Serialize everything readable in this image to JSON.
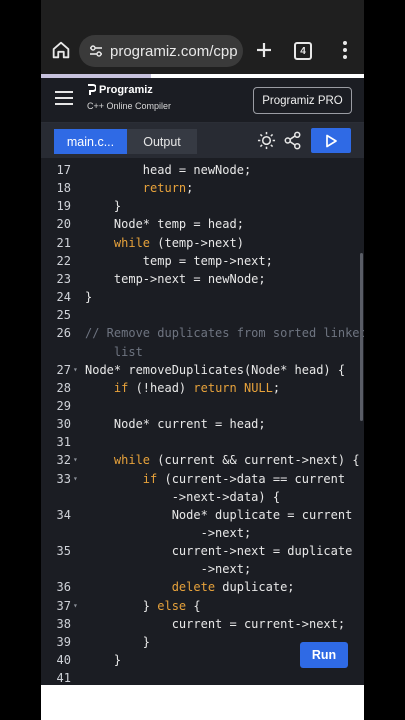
{
  "browser": {
    "url": "programiz.com/cpp-p",
    "tab_count": "4"
  },
  "header": {
    "logo_name": "Programiz",
    "logo_sub": "C++ Online Compiler",
    "pro_label": "Programiz PRO"
  },
  "toolbar": {
    "tab_main": "main.c...",
    "tab_output": "Output"
  },
  "run_label": "Run",
  "colors": {
    "accent": "#2f6ae5",
    "keyword": "#e7a23b",
    "comment": "#6e7480",
    "editor_bg": "#1b1d23"
  },
  "code_lines": [
    {
      "n": "17",
      "fold": "",
      "tokens": [
        {
          "t": "        head = newNode;"
        }
      ]
    },
    {
      "n": "18",
      "fold": "",
      "tokens": [
        {
          "t": "        "
        },
        {
          "t": "return",
          "c": "kw"
        },
        {
          "t": ";"
        }
      ]
    },
    {
      "n": "19",
      "fold": "",
      "tokens": [
        {
          "t": "    }"
        }
      ]
    },
    {
      "n": "20",
      "fold": "",
      "tokens": [
        {
          "t": "    Node* temp = head;"
        }
      ]
    },
    {
      "n": "21",
      "fold": "",
      "tokens": [
        {
          "t": "    "
        },
        {
          "t": "while",
          "c": "kw"
        },
        {
          "t": " (temp->next)"
        }
      ]
    },
    {
      "n": "22",
      "fold": "",
      "tokens": [
        {
          "t": "        temp = temp->next;"
        }
      ]
    },
    {
      "n": "23",
      "fold": "",
      "tokens": [
        {
          "t": "    temp->next = newNode;"
        }
      ]
    },
    {
      "n": "24",
      "fold": "",
      "tokens": [
        {
          "t": "}"
        }
      ]
    },
    {
      "n": "25",
      "fold": "",
      "tokens": [
        {
          "t": ""
        }
      ]
    },
    {
      "n": "26",
      "fold": "",
      "tokens": [
        {
          "t": "// Remove duplicates from sorted linked",
          "c": "cm"
        }
      ],
      "wrap": [
        {
          "t": "    list",
          "c": "cm"
        }
      ]
    },
    {
      "n": "27",
      "fold": "▾",
      "tokens": [
        {
          "t": "Node* removeDuplicates(Node* head) {"
        }
      ]
    },
    {
      "n": "28",
      "fold": "",
      "tokens": [
        {
          "t": "    "
        },
        {
          "t": "if",
          "c": "kw"
        },
        {
          "t": " (!head) "
        },
        {
          "t": "return",
          "c": "kw"
        },
        {
          "t": " "
        },
        {
          "t": "NULL",
          "c": "kw"
        },
        {
          "t": ";"
        }
      ]
    },
    {
      "n": "29",
      "fold": "",
      "tokens": [
        {
          "t": ""
        }
      ]
    },
    {
      "n": "30",
      "fold": "",
      "tokens": [
        {
          "t": "    Node* current = head;"
        }
      ]
    },
    {
      "n": "31",
      "fold": "",
      "tokens": [
        {
          "t": ""
        }
      ]
    },
    {
      "n": "32",
      "fold": "▾",
      "tokens": [
        {
          "t": "    "
        },
        {
          "t": "while",
          "c": "kw"
        },
        {
          "t": " (current && current->next) {"
        }
      ]
    },
    {
      "n": "33",
      "fold": "▾",
      "tokens": [
        {
          "t": "        "
        },
        {
          "t": "if",
          "c": "kw"
        },
        {
          "t": " (current->data == current"
        }
      ],
      "wrap": [
        {
          "t": "            ->next->data) {"
        }
      ]
    },
    {
      "n": "34",
      "fold": "",
      "tokens": [
        {
          "t": "            Node* duplicate = current"
        }
      ],
      "wrap": [
        {
          "t": "                ->next;"
        }
      ]
    },
    {
      "n": "35",
      "fold": "",
      "tokens": [
        {
          "t": "            current->next = duplicate"
        }
      ],
      "wrap": [
        {
          "t": "                ->next;"
        }
      ]
    },
    {
      "n": "36",
      "fold": "",
      "tokens": [
        {
          "t": "            "
        },
        {
          "t": "delete",
          "c": "kw"
        },
        {
          "t": " duplicate;"
        }
      ]
    },
    {
      "n": "37",
      "fold": "▾",
      "tokens": [
        {
          "t": "        } "
        },
        {
          "t": "else",
          "c": "kw"
        },
        {
          "t": " {"
        }
      ]
    },
    {
      "n": "38",
      "fold": "",
      "tokens": [
        {
          "t": "            current = current->next;"
        }
      ]
    },
    {
      "n": "39",
      "fold": "",
      "tokens": [
        {
          "t": "        }"
        }
      ]
    },
    {
      "n": "40",
      "fold": "",
      "tokens": [
        {
          "t": "    }"
        }
      ]
    },
    {
      "n": "41",
      "fold": "",
      "tokens": [
        {
          "t": ""
        }
      ]
    }
  ]
}
